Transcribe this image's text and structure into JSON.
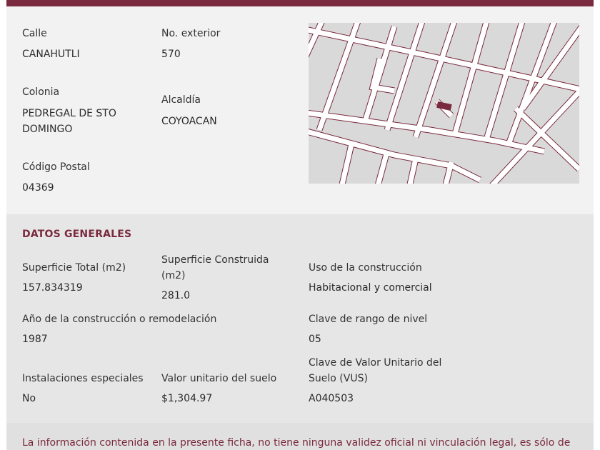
{
  "address": {
    "calle_label": "Calle",
    "calle_value": "CANAHUTLI",
    "no_ext_label": "No. exterior",
    "no_ext_value": "570",
    "colonia_label": "Colonia",
    "colonia_value_line1": "PEDREGAL DE STO",
    "colonia_value_line2": "DOMINGO",
    "alcaldia_label": "Alcaldía",
    "alcaldia_value": "COYOACAN",
    "cp_label": "Código Postal",
    "cp_value": "04369"
  },
  "general": {
    "title": "DATOS GENERALES",
    "sup_total_label": "Superficie Total (m2)",
    "sup_total_value": "157.834319",
    "sup_constr_label_line1": "Superficie Construida",
    "sup_constr_label_line2": "(m2)",
    "sup_constr_value": "281.0",
    "uso_label": "Uso de la construcción",
    "uso_value": "Habitacional y comercial",
    "anio_label": "Año de la construcción o remodelación",
    "anio_value": "1987",
    "rango_label": "Clave de rango de nivel",
    "rango_value": "05",
    "inst_label": "Instalaciones especiales",
    "inst_value": "No",
    "valor_suelo_label": "Valor unitario del suelo",
    "valor_suelo_value": "$1,304.97",
    "vus_label_line1": "Clave de Valor Unitario del",
    "vus_label_line2": "Suelo (VUS)",
    "vus_value": "A040503"
  },
  "disclaimer": {
    "text": "La información contenida en la presente ficha, no tiene ninguna validez oficial ni vinculación legal, es sólo de"
  },
  "colors": {
    "brand": "#7a2a3e",
    "map_block": "#d9d9d9",
    "map_street": "#ffffff"
  }
}
